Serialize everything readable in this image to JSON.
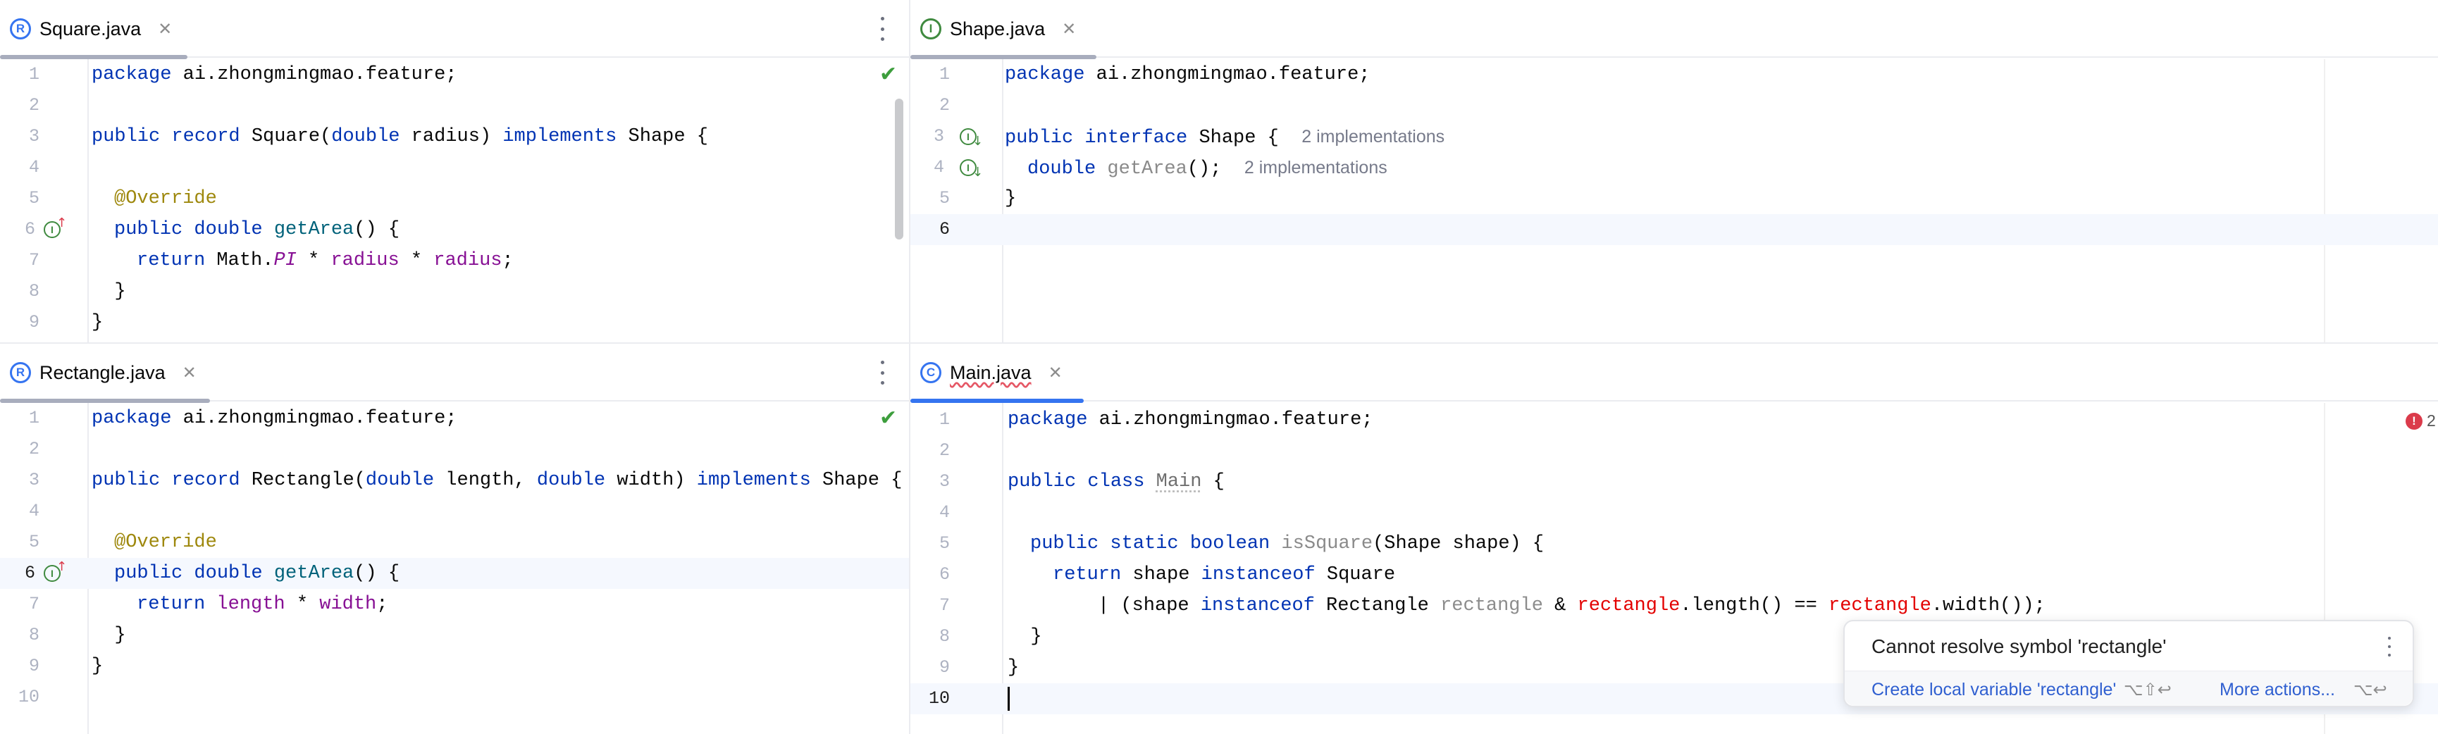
{
  "colors": {
    "accent": "#3574f0",
    "green_icon": "#3f8a3f",
    "error": "#db3b4b",
    "keyword": "#0033b3"
  },
  "panes": {
    "square": {
      "tab": {
        "icon_letter": "R",
        "title": "Square.java"
      },
      "lines": [
        "1",
        "2",
        "3",
        "4",
        "5",
        "6",
        "7",
        "8",
        "9"
      ],
      "code": {
        "l1_kw": "package",
        "l1_rest": " ai.zhongmingmao.feature;",
        "l3_kw1": "public",
        "l3_kw2": "record",
        "l3_a": " Square(",
        "l3_kw3": "double",
        "l3_b": " radius) ",
        "l3_kw4": "implements",
        "l3_c": " Shape {",
        "l5_ann": "@Override",
        "l6_kw1": "public",
        "l6_kw2": "double",
        "l6_fn": "getArea",
        "l6_rest": "() {",
        "l7_kw": "return",
        "l7_a": " Math.",
        "l7_pi": "PI",
        "l7_b": " * ",
        "l7_f1": "radius",
        "l7_c": " * ",
        "l7_f2": "radius",
        "l7_d": ";",
        "l8": "  }",
        "l9": "}"
      }
    },
    "shape": {
      "tab": {
        "icon_letter": "I",
        "title": "Shape.java"
      },
      "lines": [
        "1",
        "2",
        "3",
        "4",
        "5",
        "6"
      ],
      "code": {
        "l1_kw": "package",
        "l1_rest": " ai.zhongmingmao.feature;",
        "l3_kw1": "public",
        "l3_kw2": "interface",
        "l3_rest": " Shape {",
        "l3_hint": "2 implementations",
        "l4_kw": "double",
        "l4_fn": "getArea",
        "l4_rest": "();",
        "l4_hint": "2 implementations",
        "l5": "}"
      }
    },
    "rectangle": {
      "tab": {
        "icon_letter": "R",
        "title": "Rectangle.java"
      },
      "lines": [
        "1",
        "2",
        "3",
        "4",
        "5",
        "6",
        "7",
        "8",
        "9",
        "10"
      ],
      "code": {
        "l1_kw": "package",
        "l1_rest": " ai.zhongmingmao.feature;",
        "l3_kw1": "public",
        "l3_kw2": "record",
        "l3_a": " Rectangle(",
        "l3_kw3": "double",
        "l3_b": " length, ",
        "l3_kw4": "double",
        "l3_c": " width) ",
        "l3_kw5": "implements",
        "l3_d": " Shape {",
        "l5_ann": "@Override",
        "l6_kw1": "public",
        "l6_kw2": "double",
        "l6_fn": "getArea",
        "l6_rest": "() {",
        "l7_kw": "return",
        "l7_f1": "length",
        "l7_a": " * ",
        "l7_f2": "width",
        "l7_b": ";",
        "l8": "  }",
        "l9": "}"
      }
    },
    "main": {
      "tab": {
        "icon_letter": "C",
        "title": "Main.java"
      },
      "lines": [
        "1",
        "2",
        "3",
        "4",
        "5",
        "6",
        "7",
        "8",
        "9",
        "10"
      ],
      "error_count": "2",
      "code": {
        "l1_kw": "package",
        "l1_rest": " ai.zhongmingmao.feature;",
        "l3_kw1": "public",
        "l3_kw2": "class",
        "l3_cls": "Main",
        "l3_rest": " {",
        "l5_kw1": "public",
        "l5_kw2": "static",
        "l5_kw3": "boolean",
        "l5_fn": "isSquare",
        "l5_rest": "(Shape shape) {",
        "l6_kw1": "return",
        "l6_a": " shape ",
        "l6_kw2": "instanceof",
        "l6_b": " Square",
        "l7_a": "| (shape ",
        "l7_kw": "instanceof",
        "l7_b": " Rectangle ",
        "l7_unused": "rectangle",
        "l7_c": " & ",
        "l7_e1": "rectangle",
        "l7_d": ".length() == ",
        "l7_e2": "rectangle",
        "l7_e": ".width());",
        "l8": "  }",
        "l9": "}"
      }
    }
  },
  "popup": {
    "message": "Cannot resolve symbol 'rectangle'",
    "action1": "Create local variable 'rectangle'",
    "action1_keys": "⌥⇧↩",
    "action2": "More actions...",
    "action2_keys": "⌥↩"
  }
}
